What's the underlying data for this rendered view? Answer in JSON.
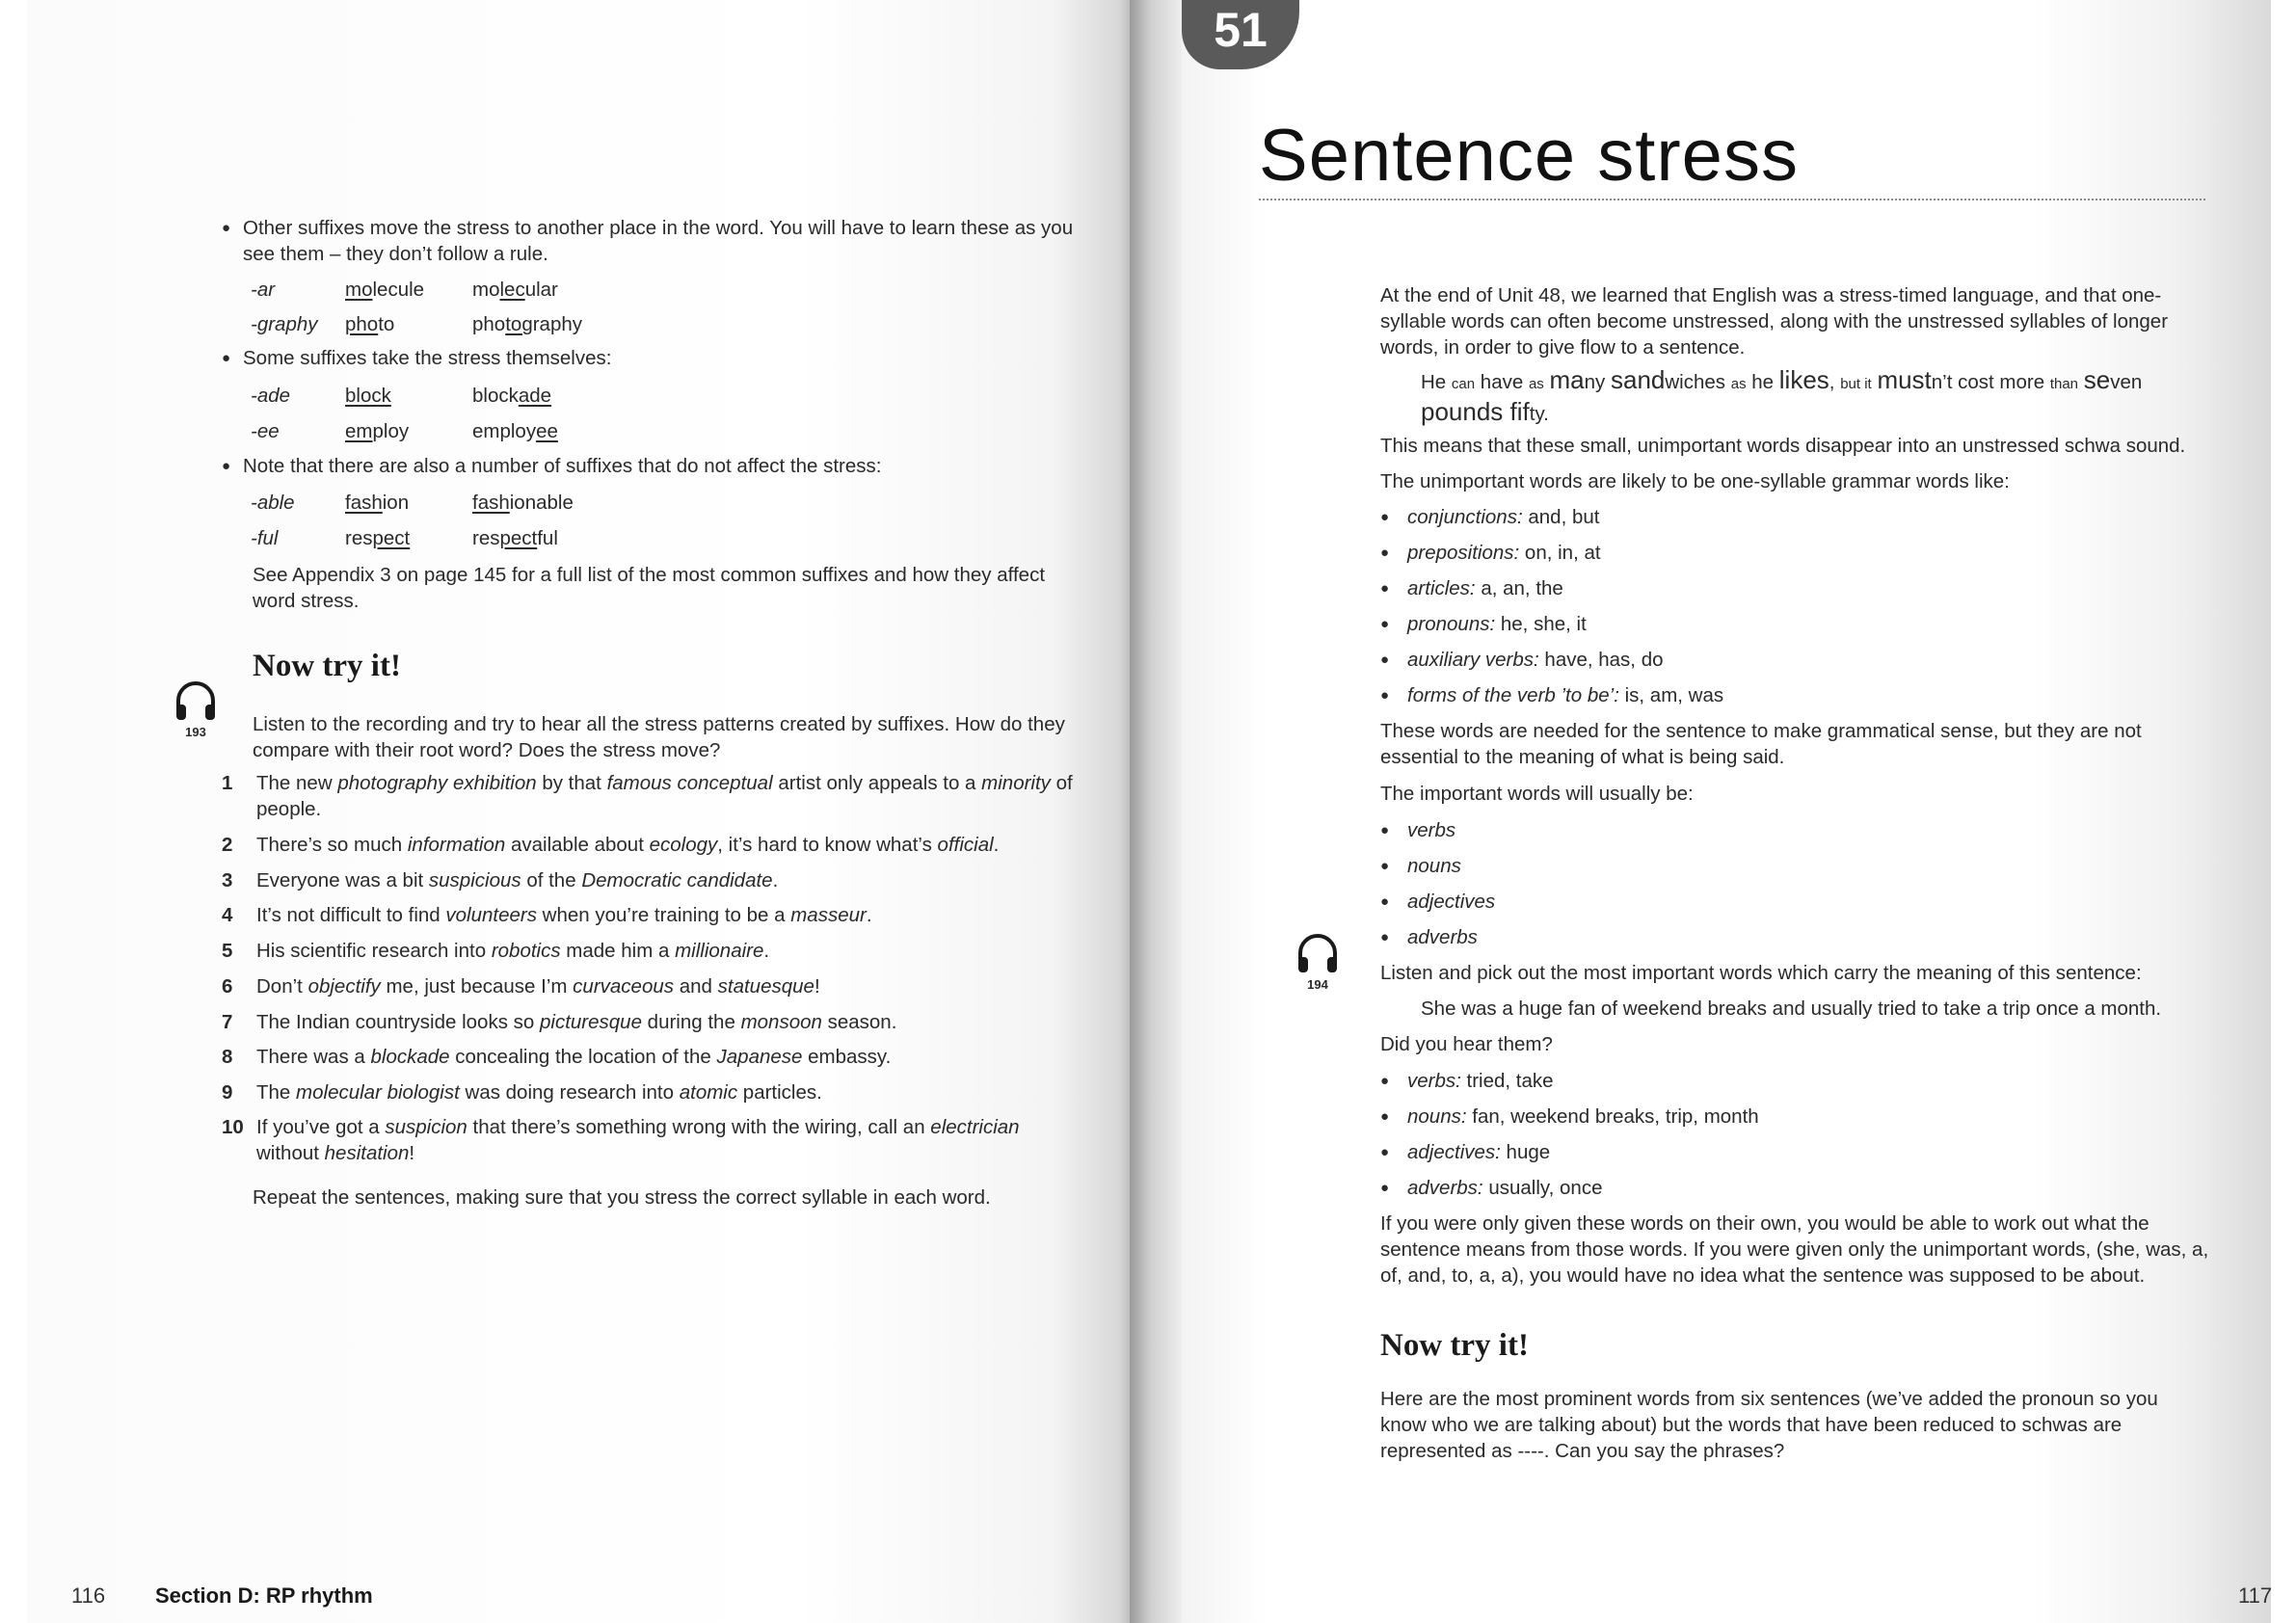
{
  "left_page": {
    "bullet1": "Other suffixes move the stress to another place in the word. You will have to learn these as you see them – they don’t follow a rule.",
    "examples1": [
      {
        "suffix": "-ar",
        "w1": [
          "",
          "mo",
          "lecule"
        ],
        "w2": [
          "mo",
          "lec",
          "ular"
        ]
      },
      {
        "suffix": "-graphy",
        "w1": [
          "",
          "pho",
          "to"
        ],
        "w2": [
          "pho",
          "tog",
          "raphy"
        ]
      }
    ],
    "bullet2": "Some suffixes take the stress themselves:",
    "examples2": [
      {
        "suffix": "-ade",
        "w1": [
          "",
          "block",
          ""
        ],
        "w2": [
          "block",
          "ade",
          ""
        ]
      },
      {
        "suffix": "-ee",
        "w1": [
          "",
          "em",
          "ploy"
        ],
        "w2": [
          "employ",
          "ee",
          ""
        ]
      }
    ],
    "bullet3": "Note that there are also a number of suffixes that do not affect the stress:",
    "examples3": [
      {
        "suffix": "-able",
        "w1": [
          "",
          "fash",
          "ion"
        ],
        "w2": [
          "",
          "fash",
          "ionable"
        ]
      },
      {
        "suffix": "-ful",
        "w1": [
          "res",
          "pect",
          ""
        ],
        "w2": [
          "res",
          "pect",
          "ful"
        ]
      }
    ],
    "appendix_note": "See Appendix 3 on page 145 for a full list of the most common suffixes and how they affect word stress.",
    "now_try_heading": "Now try it!",
    "track": "193",
    "intro": "Listen to the recording and try to hear all the stress patterns created by suffixes. How do they compare with their root word? Does the stress move?",
    "sentences": [
      {
        "n": "1",
        "html": "The new <em>photography exhibition</em> by that <em>famous conceptual</em> artist only appeals to a <em>minority</em> of people."
      },
      {
        "n": "2",
        "html": "There’s so much <em>information</em> available about <em>ecology</em>, it’s hard to know what’s <em>official</em>."
      },
      {
        "n": "3",
        "html": "Everyone was a bit <em>suspicious</em> of the <em>Democratic candidate</em>."
      },
      {
        "n": "4",
        "html": "It’s not difficult to find <em>volunteers</em> when you’re training to be a <em>masseur</em>."
      },
      {
        "n": "5",
        "html": "His scientific research into <em>robotics</em> made him a <em>millionaire</em>."
      },
      {
        "n": "6",
        "html": "Don’t <em>objectify</em> me, just because I’m <em>curvaceous</em> and <em>statuesque</em>!"
      },
      {
        "n": "7",
        "html": "The Indian countryside looks so <em>picturesque</em> during the <em>monsoon</em> season."
      },
      {
        "n": "8",
        "html": "There was a <em>blockade</em> concealing the location of the <em>Japanese</em> embassy."
      },
      {
        "n": "9",
        "html": "The <em>molecular biologist</em> was doing research into <em>atomic</em> particles."
      },
      {
        "n": "10",
        "html": "If you’ve got a <em>suspicion</em> that there’s something wrong with the wiring, call an <em>electrician</em> without <em>hesitation</em>!"
      }
    ],
    "repeat": "Repeat the sentences, making sure that you stress the correct syllable in each word.",
    "page_number": "116",
    "section": "Section D: RP rhythm"
  },
  "right_page": {
    "unit_number": "51",
    "title": "Sentence stress",
    "intro": "At the end of Unit 48, we learned that English was a stress-timed language, and that one-syllable words can often become unstressed, along with the unstressed syllables of longer words, in order to give flow to a sentence.",
    "example_sentence_html": "He <span class=\"sm\">can</span> have <span class=\"sm\">as</span> <span class=\"big\">ma</span>ny <span class=\"big\">sand</span>wiches <span class=\"sm\">as</span> he <span class=\"big\">likes</span>, <span class=\"sm\">but it</span> <span class=\"big\">must</span>n’t cost more <span class=\"sm\">than</span> <span class=\"big\">se</span>ven <span class=\"big\">pounds fif</span>ty.",
    "means": "This means that these small, unimportant words disappear into an unstressed schwa sound.",
    "unimportant_intro": "The unimportant words are likely to be one-syllable grammar words like:",
    "grammar_words": [
      {
        "label": "conjunctions:",
        "words": "and, but"
      },
      {
        "label": "prepositions:",
        "words": "on, in, at"
      },
      {
        "label": "articles:",
        "words": "a, an, the"
      },
      {
        "label": "pronouns:",
        "words": "he, she, it"
      },
      {
        "label": "auxiliary verbs:",
        "words": "have, has, do"
      },
      {
        "label": "forms of the verb ’to be’:",
        "words": "is, am, was"
      }
    ],
    "needed": "These words are needed for the sentence to make grammatical sense, but they are not essential to the meaning of what is being said.",
    "important_intro": "The important words will usually be:",
    "important_types": [
      "verbs",
      "nouns",
      "adjectives",
      "adverbs"
    ],
    "track": "194",
    "listen": "Listen and pick out the most important words which carry the meaning of this sentence:",
    "listen_sentence": "She was a huge fan of weekend breaks and usually tried to take a trip once a month.",
    "did_you_hear": "Did you hear them?",
    "answers": [
      {
        "label": "verbs:",
        "words": "tried, take"
      },
      {
        "label": "nouns:",
        "words": "fan, weekend breaks, trip, month"
      },
      {
        "label": "adjectives:",
        "words": "huge"
      },
      {
        "label": "adverbs:",
        "words": "usually, once"
      }
    ],
    "conclusion": "If you were only given these words on their own, you would be able to work out what the sentence means from those words. If you were given only the unimportant words, (she, was, a, of, and, to, a, a), you would have no idea what the sentence was supposed to be about.",
    "now_try_heading": "Now try it!",
    "now_try_text": "Here are the most prominent words from six sentences (we’ve added the pronoun so you know who we are talking about) but the words that have been reduced to schwas are represented as ----. Can you say the phrases?",
    "page_number": "117"
  }
}
